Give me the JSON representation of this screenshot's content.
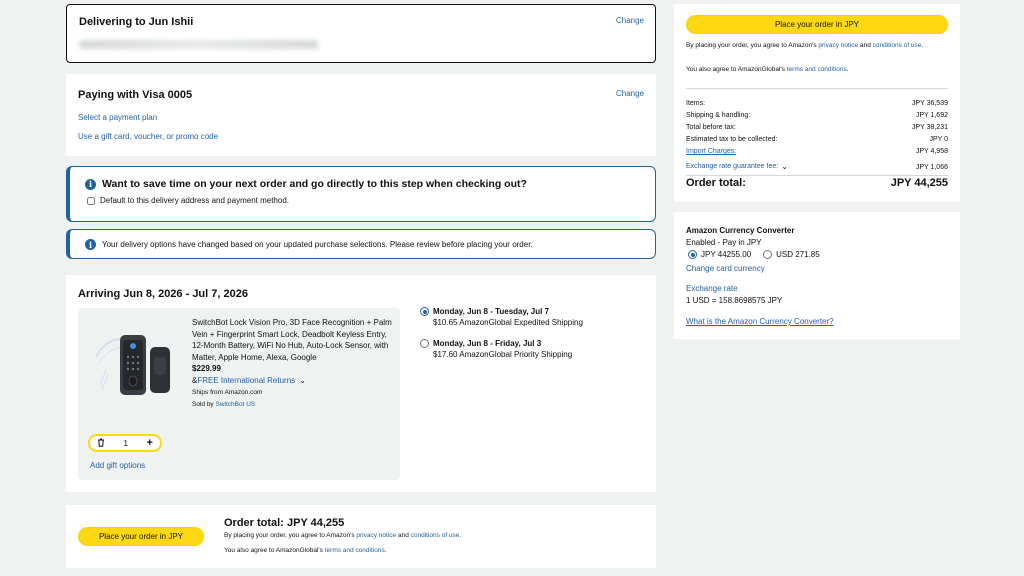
{
  "delivery": {
    "title": "Delivering to Jun Ishii",
    "change": "Change"
  },
  "payment": {
    "title": "Paying with Visa 0005",
    "change": "Change",
    "plan_link": "Select a payment plan",
    "gift_link": "Use a gift card, voucher, or promo code"
  },
  "save_time": {
    "title": "Want to save time on your next order and go directly to this step when checking out?",
    "checkbox_label": "Default to this delivery address and payment method."
  },
  "notice": {
    "text": "Your delivery options have changed based on your updated purchase selections. Please review before placing your order."
  },
  "shipment": {
    "arriving": "Arriving Jun 8, 2026 - Jul 7, 2026",
    "product": {
      "title": "SwitchBot Lock Vision Pro, 3D Face Recognition + Palm Vein + Fingerprint Smart Lock, Deadbolt Keyless Entry, 12-Month Battery, WiFi No Hub, Auto-Lock Sensor, with Matter, Apple Home, Alexa, Google",
      "price": "$229.99",
      "returns_prefix": "& ",
      "returns_link": "FREE International Returns",
      "ships_from": "Ships from Amazon.com",
      "sold_by_prefix": "Sold by ",
      "sold_by": "SwitchBot US",
      "quantity": "1",
      "gift_link": "Add gift options"
    },
    "options": [
      {
        "date": "Monday, Jun 8 - Tuesday, Jul 7",
        "price": "$10.65 AmazonGlobal Expedited Shipping",
        "selected": true
      },
      {
        "date": "Monday, Jun 8 - Friday, Jul 3",
        "price": "$17.60 AmazonGlobal Priority Shipping",
        "selected": false
      }
    ]
  },
  "bottom": {
    "button": "Place your order in JPY",
    "total": "Order total: JPY 44,255",
    "line1_prefix": "By placing your order, you agree to Amazon's ",
    "privacy": "privacy notice",
    "and": " and ",
    "conditions": "conditions of use",
    "period": ".",
    "line2_prefix": "You also agree to AmazonGlobal's ",
    "terms": "terms and conditions",
    "line2_suffix": "."
  },
  "summary": {
    "button": "Place your order in JPY",
    "agree_prefix": "By placing your order, you agree to Amazon's ",
    "privacy": "privacy notice",
    "and": " and ",
    "conditions": "conditions of use",
    "period": ".",
    "global_prefix": "You also agree to AmazonGlobal's ",
    "terms": "terms and conditions",
    "global_suffix": ".",
    "rows": [
      {
        "label": "Items:",
        "value": "JPY 36,539"
      },
      {
        "label": "Shipping & handling:",
        "value": "JPY 1,692"
      },
      {
        "label": "Total before tax:",
        "value": "JPY 38,231"
      },
      {
        "label": "Estimated tax to be collected:",
        "value": "JPY 0"
      },
      {
        "label": "Import Charges:",
        "value": "JPY 4,958"
      },
      {
        "label": "Exchange rate guarantee fee:",
        "value": "JPY 1,066"
      }
    ],
    "total_label": "Order total:",
    "total_value": "JPY 44,255"
  },
  "converter": {
    "title": "Amazon Currency Converter",
    "enabled": "Enabled - Pay in JPY",
    "opt1": "JPY 44255.00",
    "opt2": "USD 271.85",
    "change_currency": "Change card currency",
    "rate_title": "Exchange rate",
    "rate_value": "1 USD = 158.8698575 JPY",
    "what_is": "What is the Amazon Currency Converter?"
  },
  "colors": {
    "link": "#2162a1",
    "button": "#ffd814",
    "info_border": "#2162a1"
  }
}
